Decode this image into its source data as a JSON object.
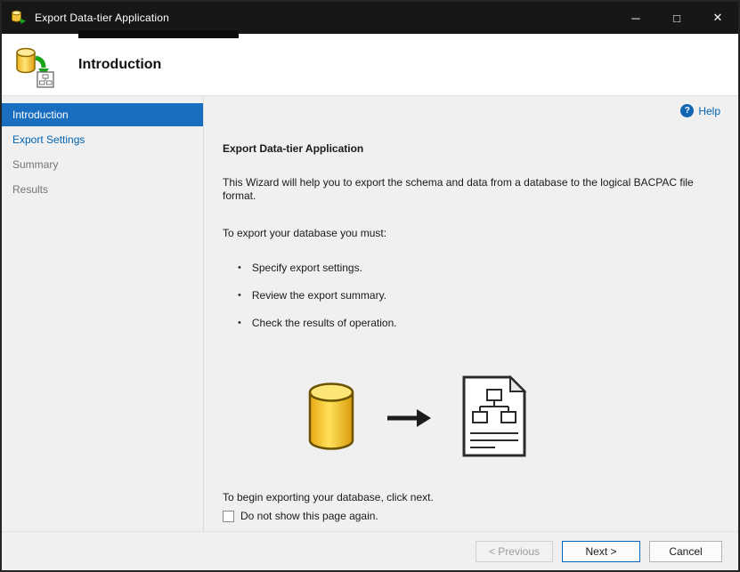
{
  "window": {
    "title": "Export Data-tier Application",
    "controls": [
      {
        "name": "minimize",
        "glyph": "─"
      },
      {
        "name": "maximize",
        "glyph": "□"
      },
      {
        "name": "close",
        "glyph": "✕"
      }
    ]
  },
  "header": {
    "title": "Introduction"
  },
  "sidebar": {
    "items": [
      {
        "label": "Introduction",
        "state": "active"
      },
      {
        "label": "Export Settings",
        "state": "link"
      },
      {
        "label": "Summary",
        "state": "disabled"
      },
      {
        "label": "Results",
        "state": "disabled"
      }
    ]
  },
  "content": {
    "help": {
      "label": "Help",
      "icon_glyph": "?"
    },
    "heading": "Export Data-tier Application",
    "intro": "This Wizard will help you to export the schema and data from a database to the logical BACPAC file format.",
    "must_label": "To export your database you must:",
    "bullet_glyph": "•",
    "bullets": [
      "Specify export settings.",
      "Review the export summary.",
      "Check the results of operation."
    ],
    "begin_text": "To begin exporting your database, click next.",
    "checkbox_label": "Do not show this page again.",
    "checkbox_checked": false
  },
  "footer": {
    "previous_label": "< Previous",
    "next_label": "Next >",
    "cancel_label": "Cancel"
  },
  "icons": {
    "app": "database-export-icon",
    "header": "database-export-document-icon",
    "help": "help-circle-icon",
    "illustration": [
      "database-cylinder-icon",
      "right-arrow-icon",
      "bacpac-document-icon"
    ]
  },
  "colors": {
    "sidebar_active_bg": "#1a6ebf",
    "link_blue": "#0063b1",
    "next_button_border": "#0067c0",
    "titlebar_bg": "#171717"
  }
}
